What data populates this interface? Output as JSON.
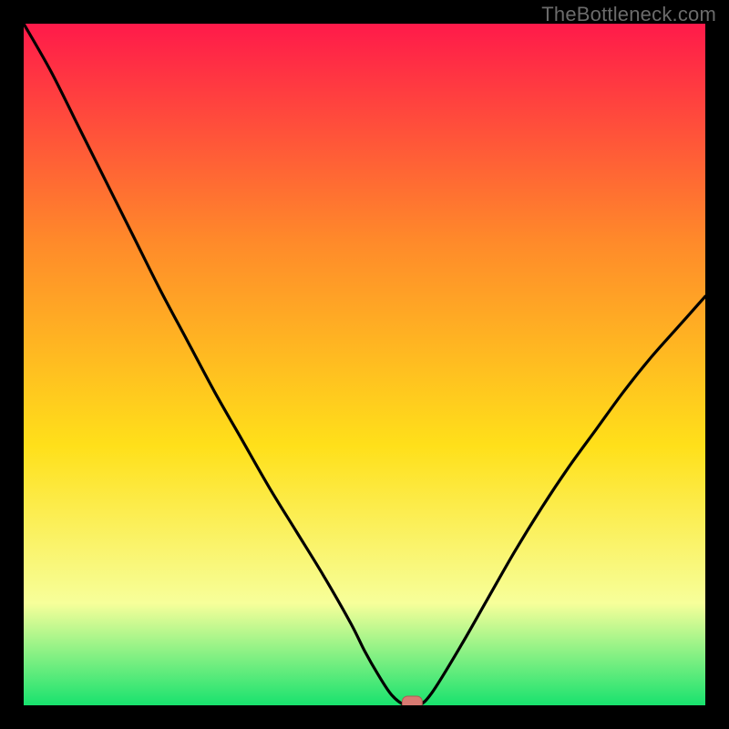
{
  "attribution": "TheBottleneck.com",
  "colors": {
    "top": "#ff1a4a",
    "upper_mid": "#ff8a2a",
    "mid": "#ffe01a",
    "lower_mid": "#f7ff9a",
    "bottom": "#18e26e",
    "frame": "#000000",
    "curve": "#000000",
    "marker_fill": "#d87a72",
    "marker_stroke": "#b15a54",
    "attribution_text": "#6b6b6b"
  },
  "chart_data": {
    "type": "line",
    "title": "",
    "xlabel": "",
    "ylabel": "",
    "xlim": [
      0,
      100
    ],
    "ylim": [
      0,
      100
    ],
    "x": [
      0,
      4,
      8,
      12,
      16,
      20,
      24,
      28,
      32,
      36,
      40,
      44,
      48,
      50,
      52,
      54,
      56,
      58,
      60,
      64,
      68,
      72,
      76,
      80,
      84,
      88,
      92,
      96,
      100
    ],
    "values": [
      100,
      93,
      85,
      77,
      69,
      61,
      53.5,
      46,
      39,
      32,
      25.5,
      19,
      12,
      8,
      4.5,
      1.5,
      0,
      0,
      2,
      8.5,
      15.5,
      22.5,
      29,
      35,
      40.5,
      46,
      51,
      55.5,
      60
    ],
    "marker": {
      "x": 57,
      "y": 0
    },
    "legend": null,
    "annotations": []
  }
}
